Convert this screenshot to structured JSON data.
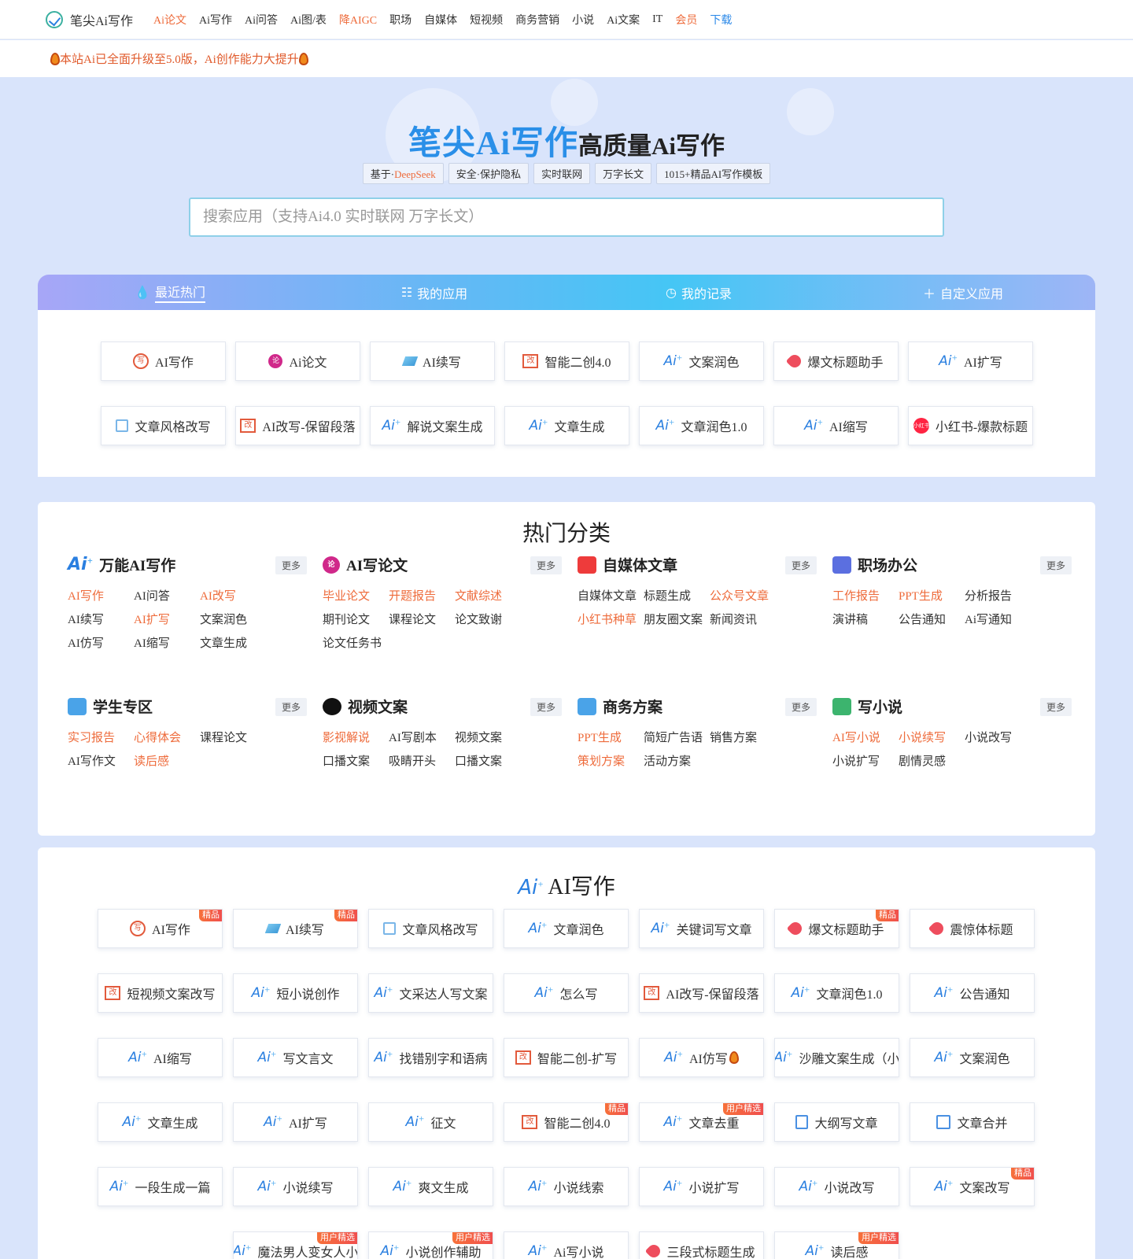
{
  "nav": {
    "logo": "笔尖Ai写作",
    "items": [
      {
        "label": "Ai论文",
        "tone": "orange"
      },
      {
        "label": "Ai写作",
        "tone": ""
      },
      {
        "label": "Ai问答",
        "tone": ""
      },
      {
        "label": "Ai图/表",
        "tone": ""
      },
      {
        "label": "降AIGC",
        "tone": "orange"
      },
      {
        "label": "职场",
        "tone": ""
      },
      {
        "label": "自媒体",
        "tone": ""
      },
      {
        "label": "短视频",
        "tone": ""
      },
      {
        "label": "商务营销",
        "tone": ""
      },
      {
        "label": "小说",
        "tone": ""
      },
      {
        "label": "Ai文案",
        "tone": ""
      },
      {
        "label": "IT",
        "tone": ""
      },
      {
        "label": "会员",
        "tone": "orange"
      },
      {
        "label": "下载",
        "tone": "blue"
      }
    ]
  },
  "notice": "本站Ai已全面升级至5.0版，Ai创作能力大提升",
  "hero": {
    "title_big": "笔尖Ai写作",
    "title_small": "高质量Ai写作",
    "tag_prefix": "基于·",
    "tag_highlight": "DeepSeek",
    "tags": [
      "安全·保护隐私",
      "实时联网",
      "万字长文",
      "1015+精品AI写作模板"
    ],
    "search_placeholder": "搜索应用（支持Ai4.0 实时联网 万字长文）"
  },
  "tabs": [
    {
      "label": "最近热门",
      "icon": "💧"
    },
    {
      "label": "我的应用",
      "icon": "☷"
    },
    {
      "label": "我的记录",
      "icon": "◷"
    },
    {
      "label": "自定义应用",
      "icon": "＋"
    }
  ],
  "recent": [
    {
      "label": "AI写作",
      "icon": "circle-red"
    },
    {
      "label": "Ai论文",
      "icon": "pink"
    },
    {
      "label": "AI续写",
      "icon": "pencil"
    },
    {
      "label": "智能二创4.0",
      "icon": "box-red"
    },
    {
      "label": "文案润色",
      "icon": "ai"
    },
    {
      "label": "爆文标题助手",
      "icon": "tag-red"
    },
    {
      "label": "AI扩写",
      "icon": "ai"
    },
    {
      "label": "文章风格改写",
      "icon": "edit"
    },
    {
      "label": "AI改写-保留段落",
      "icon": "box-red"
    },
    {
      "label": "解说文案生成",
      "icon": "ai"
    },
    {
      "label": "文章生成",
      "icon": "ai"
    },
    {
      "label": "文章润色1.0",
      "icon": "ai"
    },
    {
      "label": "AI缩写",
      "icon": "ai"
    },
    {
      "label": "小红书-爆款标题",
      "icon": "xhs"
    }
  ],
  "categories_title": "热门分类",
  "more_label": "更多",
  "categories": [
    {
      "title": "万能AI写作",
      "icon": "ai",
      "links": [
        {
          "t": "AI写作",
          "o": true
        },
        {
          "t": "AI问答",
          "o": false
        },
        {
          "t": "AI改写",
          "o": true
        },
        {
          "t": "AI续写",
          "o": false
        },
        {
          "t": "AI扩写",
          "o": true
        },
        {
          "t": "文案润色",
          "o": false
        },
        {
          "t": "AI仿写",
          "o": false
        },
        {
          "t": "AI缩写",
          "o": false
        },
        {
          "t": "文章生成",
          "o": false
        }
      ]
    },
    {
      "title": "AI写论文",
      "icon": "pink",
      "links": [
        {
          "t": "毕业论文",
          "o": true
        },
        {
          "t": "开题报告",
          "o": true
        },
        {
          "t": "文献综述",
          "o": true
        },
        {
          "t": "期刊论文",
          "o": false
        },
        {
          "t": "课程论文",
          "o": false
        },
        {
          "t": "论文致谢",
          "o": false
        },
        {
          "t": "论文任务书",
          "o": false
        }
      ]
    },
    {
      "title": "自媒体文章",
      "icon": "media",
      "links": [
        {
          "t": "自媒体文章",
          "o": false
        },
        {
          "t": "标题生成",
          "o": false
        },
        {
          "t": "公众号文章",
          "o": true
        },
        {
          "t": "小红书种草",
          "o": true
        },
        {
          "t": "朋友圈文案",
          "o": false
        },
        {
          "t": "新闻资讯",
          "o": false
        }
      ]
    },
    {
      "title": "职场办公",
      "icon": "office",
      "links": [
        {
          "t": "工作报告",
          "o": true
        },
        {
          "t": "PPT生成",
          "o": true
        },
        {
          "t": "分析报告",
          "o": false
        },
        {
          "t": "演讲稿",
          "o": false
        },
        {
          "t": "公告通知",
          "o": false
        },
        {
          "t": "Ai写通知",
          "o": false
        }
      ]
    },
    {
      "title": "学生专区",
      "icon": "student",
      "links": [
        {
          "t": "实习报告",
          "o": true
        },
        {
          "t": "心得体会",
          "o": true
        },
        {
          "t": "课程论文",
          "o": false
        },
        {
          "t": "AI写作文",
          "o": false
        },
        {
          "t": "读后感",
          "o": true
        }
      ]
    },
    {
      "title": "视频文案",
      "icon": "tiktok",
      "links": [
        {
          "t": "影视解说",
          "o": true
        },
        {
          "t": "AI写剧本",
          "o": false
        },
        {
          "t": "视频文案",
          "o": false
        },
        {
          "t": "口播文案",
          "o": false
        },
        {
          "t": "吸睛开头",
          "o": false
        },
        {
          "t": "口播文案",
          "o": false
        }
      ]
    },
    {
      "title": "商务方案",
      "icon": "biz",
      "links": [
        {
          "t": "PPT生成",
          "o": true
        },
        {
          "t": "简短广告语",
          "o": false
        },
        {
          "t": "销售方案",
          "o": false
        },
        {
          "t": "策划方案",
          "o": true
        },
        {
          "t": "活动方案",
          "o": false
        }
      ]
    },
    {
      "title": "写小说",
      "icon": "book",
      "links": [
        {
          "t": "AI写小说",
          "o": true
        },
        {
          "t": "小说续写",
          "o": true
        },
        {
          "t": "小说改写",
          "o": false
        },
        {
          "t": "小说扩写",
          "o": false
        },
        {
          "t": "剧情灵感",
          "o": false
        }
      ]
    }
  ],
  "writing_title": "AI写作",
  "writing": [
    {
      "label": "AI写作",
      "icon": "circle-red",
      "badge": "精品"
    },
    {
      "label": "AI续写",
      "icon": "pencil",
      "badge": "精品"
    },
    {
      "label": "文章风格改写",
      "icon": "edit",
      "badge": ""
    },
    {
      "label": "文章润色",
      "icon": "ai",
      "badge": ""
    },
    {
      "label": "关键词写文章",
      "icon": "ai",
      "badge": ""
    },
    {
      "label": "爆文标题助手",
      "icon": "tag-red",
      "badge": "精品"
    },
    {
      "label": "震惊体标题",
      "icon": "tag-red",
      "badge": ""
    },
    {
      "label": "短视频文案改写",
      "icon": "box-red",
      "badge": ""
    },
    {
      "label": "短小说创作",
      "icon": "ai",
      "badge": ""
    },
    {
      "label": "文采达人写文案",
      "icon": "ai",
      "badge": ""
    },
    {
      "label": "怎么写",
      "icon": "ai",
      "badge": ""
    },
    {
      "label": "AI改写-保留段落",
      "icon": "box-red",
      "badge": ""
    },
    {
      "label": "文章润色1.0",
      "icon": "ai",
      "badge": ""
    },
    {
      "label": "公告通知",
      "icon": "ai",
      "badge": ""
    },
    {
      "label": "AI缩写",
      "icon": "ai",
      "badge": ""
    },
    {
      "label": "写文言文",
      "icon": "ai",
      "badge": ""
    },
    {
      "label": "找错别字和语病",
      "icon": "ai",
      "badge": ""
    },
    {
      "label": "智能二创-扩写",
      "icon": "box-red",
      "badge": ""
    },
    {
      "label": "AI仿写",
      "icon": "ai",
      "badge": "",
      "flame": true
    },
    {
      "label": "沙雕文案生成（小",
      "icon": "ai",
      "badge": ""
    },
    {
      "label": "文案润色",
      "icon": "ai",
      "badge": ""
    },
    {
      "label": "文章生成",
      "icon": "ai",
      "badge": ""
    },
    {
      "label": "AI扩写",
      "icon": "ai",
      "badge": ""
    },
    {
      "label": "征文",
      "icon": "ai",
      "badge": ""
    },
    {
      "label": "智能二创4.0",
      "icon": "box-red",
      "badge": "精品"
    },
    {
      "label": "文章去重",
      "icon": "ai",
      "badge": "用户精选"
    },
    {
      "label": "大纲写文章",
      "icon": "list",
      "badge": ""
    },
    {
      "label": "文章合并",
      "icon": "merge",
      "badge": ""
    },
    {
      "label": "一段生成一篇",
      "icon": "ai",
      "badge": ""
    },
    {
      "label": "小说续写",
      "icon": "ai",
      "badge": ""
    },
    {
      "label": "爽文生成",
      "icon": "ai",
      "badge": ""
    },
    {
      "label": "小说线索",
      "icon": "ai",
      "badge": ""
    },
    {
      "label": "小说扩写",
      "icon": "ai",
      "badge": ""
    },
    {
      "label": "小说改写",
      "icon": "ai",
      "badge": ""
    },
    {
      "label": "文案改写",
      "icon": "ai",
      "badge": "精品"
    },
    {
      "label": "魔法男人变女人小",
      "icon": "ai",
      "badge": "用户精选"
    },
    {
      "label": "小说创作辅助",
      "icon": "ai",
      "badge": "用户精选"
    },
    {
      "label": "Ai写小说",
      "icon": "ai",
      "badge": ""
    },
    {
      "label": "三段式标题生成",
      "icon": "tag-red",
      "badge": ""
    },
    {
      "label": "读后感",
      "icon": "ai",
      "badge": "用户精选"
    }
  ],
  "colors": {
    "accent_blue": "#2a8fe8",
    "accent_orange": "#ee6b3b",
    "page_bg": "#d9e4fb"
  }
}
